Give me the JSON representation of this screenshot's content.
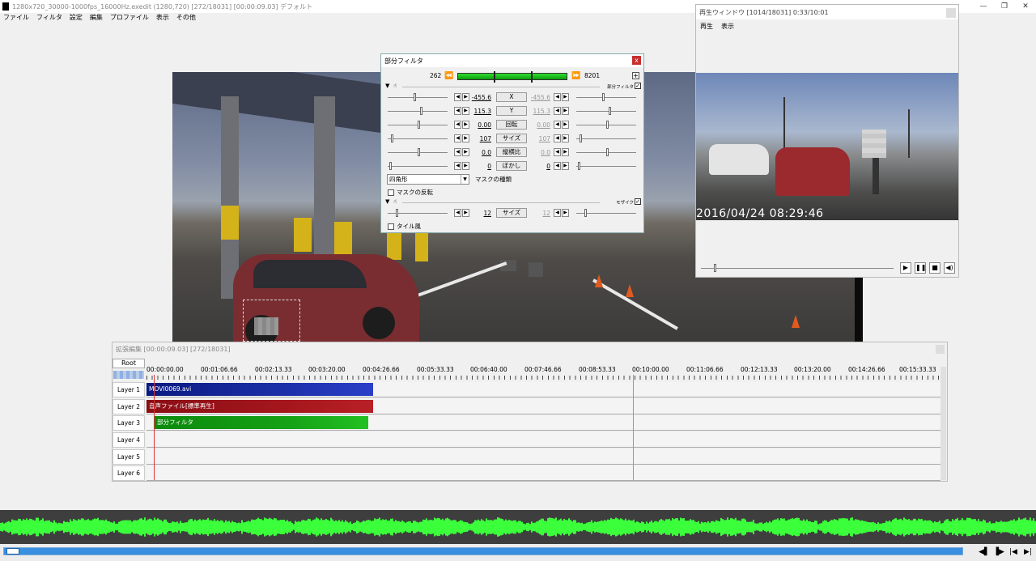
{
  "main_window": {
    "title": "1280x720_30000-1000fps_16000Hz.exedit (1280,720)  [272/18031] [00:00:09.03]  デフォルト",
    "menu": [
      "ファイル",
      "フィルタ",
      "設定",
      "編集",
      "プロファイル",
      "表示",
      "その他"
    ],
    "controls": {
      "minimize": "—",
      "maximize": "❐",
      "close": "✕"
    }
  },
  "filter_dialog": {
    "title": "部分フィルタ",
    "close_label": "x",
    "frame_start": "262",
    "frame_end": "8201",
    "section1_label": "部分フィルタ",
    "params": [
      {
        "name": "X",
        "left": "-455.6",
        "right": "-455.6"
      },
      {
        "name": "Y",
        "left": "115.3",
        "right": "115.3"
      },
      {
        "name": "回転",
        "left": "0.00",
        "right": "0.00"
      },
      {
        "name": "サイズ",
        "left": "107",
        "right": "107"
      },
      {
        "name": "縦横比",
        "left": "0.0",
        "right": "0.0"
      },
      {
        "name": "ぼかし",
        "left": "0",
        "right": "0"
      }
    ],
    "mask_shape": "四角形",
    "mask_type_label": "マスクの種類",
    "mask_invert_label": "マスクの反転",
    "section2_label": "モザイク",
    "mosaic_param": {
      "name": "サイズ",
      "left": "12",
      "right": "12"
    },
    "tile_label": "タイル風"
  },
  "play_window": {
    "title": "再生ウィンドウ  [1014/18031]  0:33/10:01",
    "menu": [
      "再生",
      "表示"
    ],
    "timestamp": "2016/04/24 08:29:46"
  },
  "timeline": {
    "title": "拡張編集 [00:00:09.03] [272/18031]",
    "root_label": "Root",
    "ticks": [
      "00:00:00.00",
      "00:01:06.66",
      "00:02:13.33",
      "00:03:20.00",
      "00:04:26.66",
      "00:05:33.33",
      "00:06:40.00",
      "00:07:46.66",
      "00:08:53.33",
      "00:10:00.00",
      "00:11:06.66",
      "00:12:13.33",
      "00:13:20.00",
      "00:14:26.66",
      "00:15:33.33"
    ],
    "layers": [
      "Layer 1",
      "Layer 2",
      "Layer 3",
      "Layer 4",
      "Layer 5",
      "Layer 6"
    ],
    "clips": [
      {
        "label": "MOVI0069.avi",
        "color": "#1c2fa8"
      },
      {
        "label": "音声ファイル[標準再生]",
        "color": "#a4161c"
      },
      {
        "label": "部分フィルタ",
        "color": "#15a015"
      }
    ]
  },
  "colors": {
    "waveform": "#3bff3b",
    "seek": "#3a8fe0"
  }
}
